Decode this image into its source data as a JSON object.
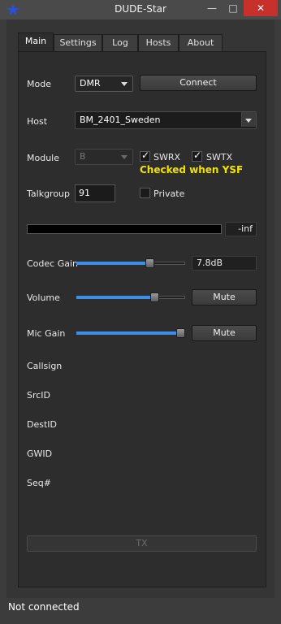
{
  "window": {
    "title": "DUDE-Star"
  },
  "tabs": [
    {
      "label": "Main"
    },
    {
      "label": "Settings"
    },
    {
      "label": "Log"
    },
    {
      "label": "Hosts"
    },
    {
      "label": "About"
    }
  ],
  "main": {
    "mode_label": "Mode",
    "mode_value": "DMR",
    "connect_label": "Connect",
    "host_label": "Host",
    "host_value": "BM_2401_Sweden",
    "module_label": "Module",
    "module_value": "B",
    "swrx_label": "SWRX",
    "swtx_label": "SWTX",
    "checked_note": "Checked when YSF",
    "talkgroup_label": "Talkgroup",
    "talkgroup_value": "91",
    "private_label": "Private",
    "level_readout": "-inf",
    "codec_gain_label": "Codec Gain",
    "codec_gain_value": "7.8dB",
    "codec_gain_level": 0.7,
    "volume_label": "Volume",
    "volume_level": 0.75,
    "mute_label": "Mute",
    "mic_gain_label": "Mic Gain",
    "mic_gain_level": 1.0,
    "mic_mute_label": "Mute",
    "callsign_label": "Callsign",
    "srcid_label": "SrcID",
    "destid_label": "DestID",
    "gwid_label": "GWID",
    "seq_label": "Seq#",
    "tx_label": "TX"
  },
  "status": {
    "text": "Not connected"
  },
  "colors": {
    "accent": "#3d8ee6",
    "note": "#f2e200",
    "close": "#c7302b"
  }
}
